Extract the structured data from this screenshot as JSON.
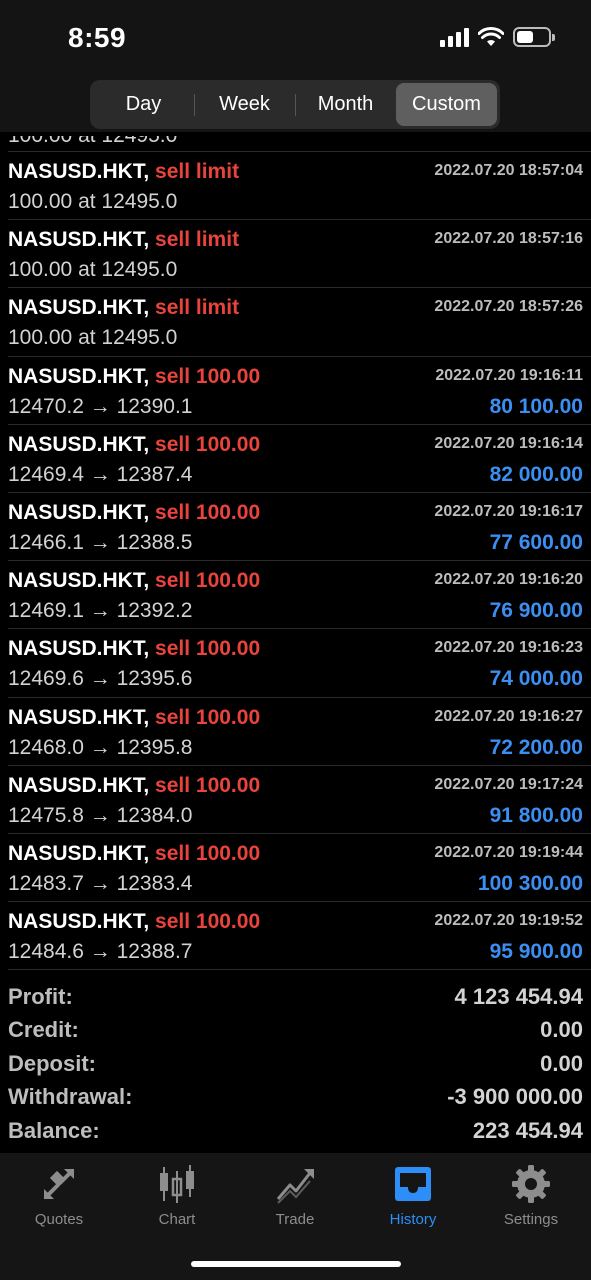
{
  "status_bar": {
    "time": "8:59"
  },
  "segments": [
    {
      "label": "Day",
      "active": false
    },
    {
      "label": "Week",
      "active": false
    },
    {
      "label": "Month",
      "active": false
    },
    {
      "label": "Custom",
      "active": true
    }
  ],
  "partial_row": {
    "price": "100.00 at 12495.0"
  },
  "rows": [
    {
      "symbol": "NASUSD.HKT,",
      "action": "sell limit",
      "datetime": "2022.07.20 18:57:04",
      "price": "100.00 at 12495.0",
      "profit": ""
    },
    {
      "symbol": "NASUSD.HKT,",
      "action": "sell limit",
      "datetime": "2022.07.20 18:57:16",
      "price": "100.00 at 12495.0",
      "profit": ""
    },
    {
      "symbol": "NASUSD.HKT,",
      "action": "sell limit",
      "datetime": "2022.07.20 18:57:26",
      "price": "100.00 at 12495.0",
      "profit": ""
    },
    {
      "symbol": "NASUSD.HKT,",
      "action": "sell 100.00",
      "datetime": "2022.07.20 19:16:11",
      "price": "12470.2 → 12390.1",
      "profit": "80 100.00"
    },
    {
      "symbol": "NASUSD.HKT,",
      "action": "sell 100.00",
      "datetime": "2022.07.20 19:16:14",
      "price": "12469.4 → 12387.4",
      "profit": "82 000.00"
    },
    {
      "symbol": "NASUSD.HKT,",
      "action": "sell 100.00",
      "datetime": "2022.07.20 19:16:17",
      "price": "12466.1 → 12388.5",
      "profit": "77 600.00"
    },
    {
      "symbol": "NASUSD.HKT,",
      "action": "sell 100.00",
      "datetime": "2022.07.20 19:16:20",
      "price": "12469.1 → 12392.2",
      "profit": "76 900.00"
    },
    {
      "symbol": "NASUSD.HKT,",
      "action": "sell 100.00",
      "datetime": "2022.07.20 19:16:23",
      "price": "12469.6 → 12395.6",
      "profit": "74 000.00"
    },
    {
      "symbol": "NASUSD.HKT,",
      "action": "sell 100.00",
      "datetime": "2022.07.20 19:16:27",
      "price": "12468.0 → 12395.8",
      "profit": "72 200.00"
    },
    {
      "symbol": "NASUSD.HKT,",
      "action": "sell 100.00",
      "datetime": "2022.07.20 19:17:24",
      "price": "12475.8 → 12384.0",
      "profit": "91 800.00"
    },
    {
      "symbol": "NASUSD.HKT,",
      "action": "sell 100.00",
      "datetime": "2022.07.20 19:19:44",
      "price": "12483.7 → 12383.4",
      "profit": "100 300.00"
    },
    {
      "symbol": "NASUSD.HKT,",
      "action": "sell 100.00",
      "datetime": "2022.07.20 19:19:52",
      "price": "12484.6 → 12388.7",
      "profit": "95 900.00"
    }
  ],
  "summary": [
    {
      "label": "Profit:",
      "value": "4 123 454.94"
    },
    {
      "label": "Credit:",
      "value": "0.00"
    },
    {
      "label": "Deposit:",
      "value": "0.00"
    },
    {
      "label": "Withdrawal:",
      "value": "-3 900 000.00"
    },
    {
      "label": "Balance:",
      "value": "223 454.94"
    }
  ],
  "tabs": [
    {
      "label": "Quotes",
      "icon": "quotes-icon",
      "active": false
    },
    {
      "label": "Chart",
      "icon": "chart-icon",
      "active": false
    },
    {
      "label": "Trade",
      "icon": "trade-icon",
      "active": false
    },
    {
      "label": "History",
      "icon": "history-icon",
      "active": true
    },
    {
      "label": "Settings",
      "icon": "gear-icon",
      "active": false
    }
  ],
  "colors": {
    "action_red": "#e8433c",
    "profit_blue": "#3b8ff2",
    "tab_active": "#2c8ef6",
    "tab_inactive": "#8d8d8d"
  }
}
